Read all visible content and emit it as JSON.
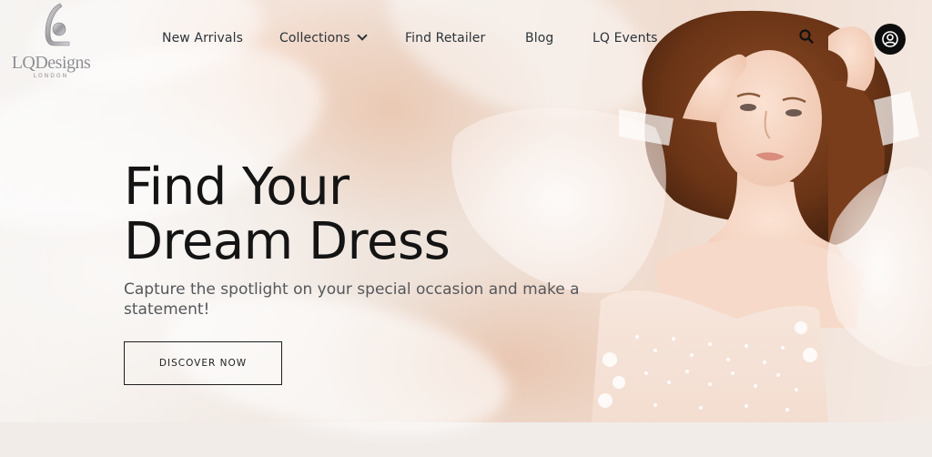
{
  "brand": {
    "logo_text": "LQDesigns",
    "logo_subtext": "LONDON"
  },
  "nav": {
    "items": [
      {
        "label": "New Arrivals",
        "has_dropdown": false
      },
      {
        "label": "Collections",
        "has_dropdown": true
      },
      {
        "label": "Find Retailer",
        "has_dropdown": false
      },
      {
        "label": "Blog",
        "has_dropdown": false
      },
      {
        "label": "LQ Events",
        "has_dropdown": false
      }
    ],
    "search_icon": "search-icon",
    "account_icon": "user-circle-icon"
  },
  "hero": {
    "headline_line1": "Find Your",
    "headline_line2": "Dream Dress",
    "subline": "Capture the spotlight on your special occasion and make a statement!",
    "cta_label": "DISCOVER NOW"
  },
  "colors": {
    "text_dark": "#141414",
    "nav_text": "#2c3339",
    "subtext": "#55575b",
    "account_button_bg": "#0d0d0d",
    "hero_blush": "#efdccf"
  }
}
